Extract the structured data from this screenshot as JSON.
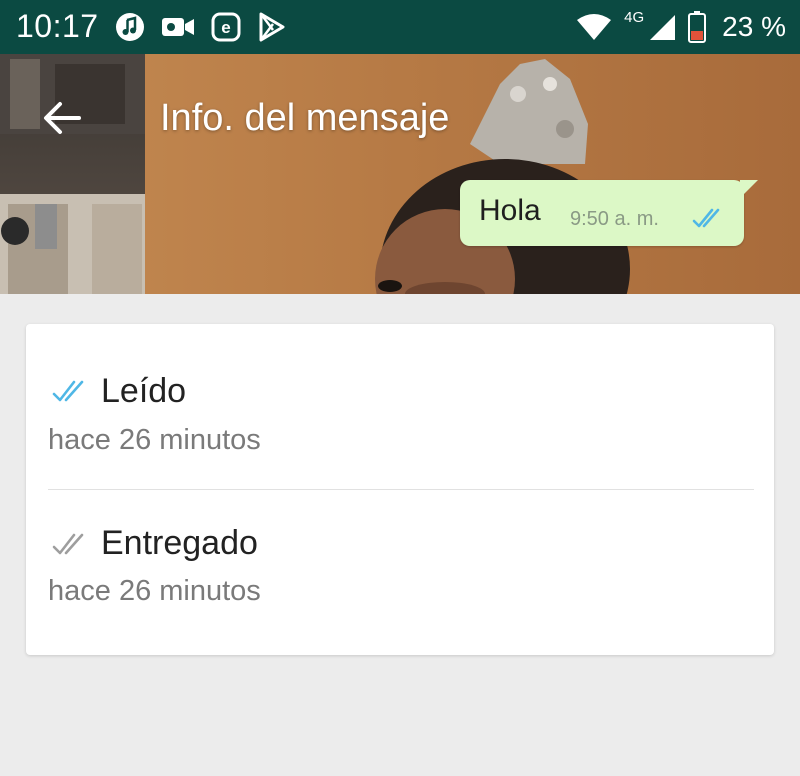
{
  "status_bar": {
    "time": "10:17",
    "network_type": "4G",
    "battery_percent": "23 %",
    "icons_left": [
      "music-app-icon",
      "video-camera-icon",
      "e-app-icon",
      "play-store-icon"
    ],
    "icons_right": [
      "wifi-icon",
      "signal-icon",
      "battery-icon"
    ],
    "background_color": "#0b4a42"
  },
  "header": {
    "title": "Info. del mensaje",
    "back_icon": "arrow-back-icon"
  },
  "message": {
    "text": "Hola",
    "time": "9:50 a. m.",
    "bubble_color": "#dcf8c6",
    "tick_color": "#4fb7e6"
  },
  "receipts": [
    {
      "label": "Leído",
      "time": "hace 26 minutos",
      "icon": "double-check-blue-icon",
      "tick_color": "#4fb7e6"
    },
    {
      "label": "Entregado",
      "time": "hace 26 minutos",
      "icon": "double-check-gray-icon",
      "tick_color": "#9e9e9e"
    }
  ]
}
